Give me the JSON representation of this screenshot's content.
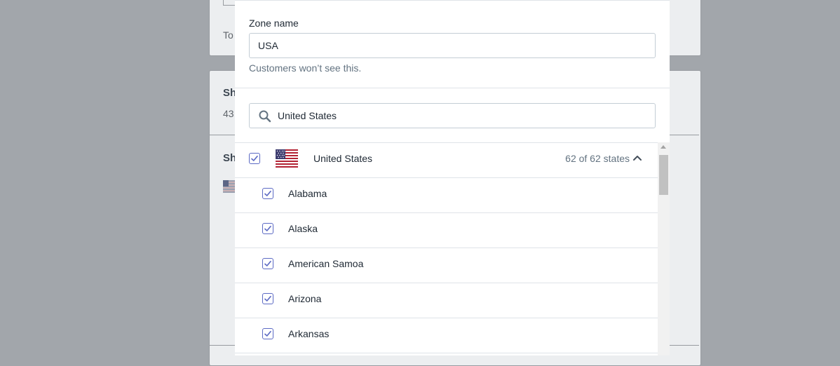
{
  "background": {
    "card1_text": "To",
    "card2_title": "Sh",
    "card2_sub": "43",
    "card3_title": "Sh"
  },
  "zone": {
    "label": "Zone name",
    "value": "USA",
    "help": "Customers won’t see this."
  },
  "search": {
    "value": "United States",
    "icon": "search-icon"
  },
  "country": {
    "name": "United States",
    "count": "62 of 62 states",
    "checked": true
  },
  "states": [
    {
      "name": "Alabama",
      "checked": true
    },
    {
      "name": "Alaska",
      "checked": true
    },
    {
      "name": "American Samoa",
      "checked": true
    },
    {
      "name": "Arizona",
      "checked": true
    },
    {
      "name": "Arkansas",
      "checked": true
    }
  ],
  "colors": {
    "accent": "#5c6ac4",
    "border": "#c4cdd5",
    "subdued_text": "#637381"
  }
}
